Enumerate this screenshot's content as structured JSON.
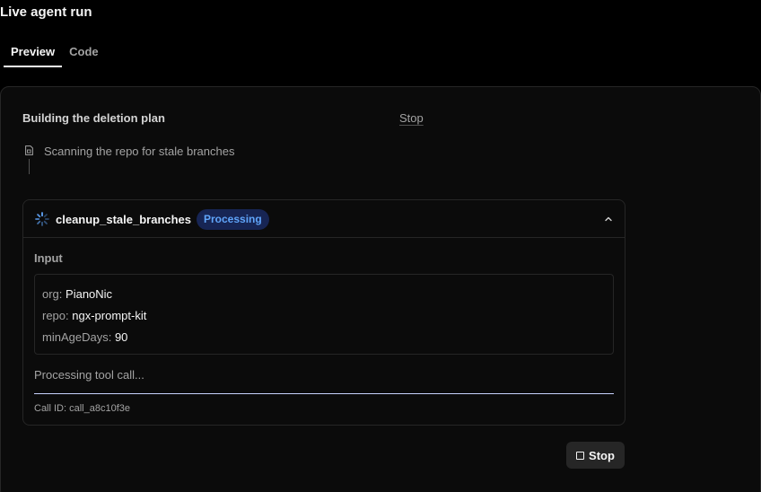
{
  "page": {
    "title": "Live agent run"
  },
  "tabs": [
    {
      "label": "Preview",
      "active": true
    },
    {
      "label": "Code",
      "active": false
    }
  ],
  "plan": {
    "title": "Building the deletion plan",
    "stop_label": "Stop",
    "step": {
      "text": "Scanning the repo for stale branches",
      "icon": "file-icon"
    }
  },
  "tool_call": {
    "name": "cleanup_stale_branches",
    "status": "Processing",
    "input_label": "Input",
    "inputs": [
      {
        "key": "org:",
        "value": "PianoNic"
      },
      {
        "key": "repo:",
        "value": "ngx-prompt-kit"
      },
      {
        "key": "minAgeDays:",
        "value": "90"
      }
    ],
    "processing_text": "Processing tool call...",
    "call_id": "Call ID: call_a8c10f3e"
  },
  "footer": {
    "stop_label": "Stop"
  },
  "colors": {
    "accent": "#60a5fa",
    "badge_bg": "#172554",
    "background": "#000000",
    "panel": "#0b0b0b"
  }
}
